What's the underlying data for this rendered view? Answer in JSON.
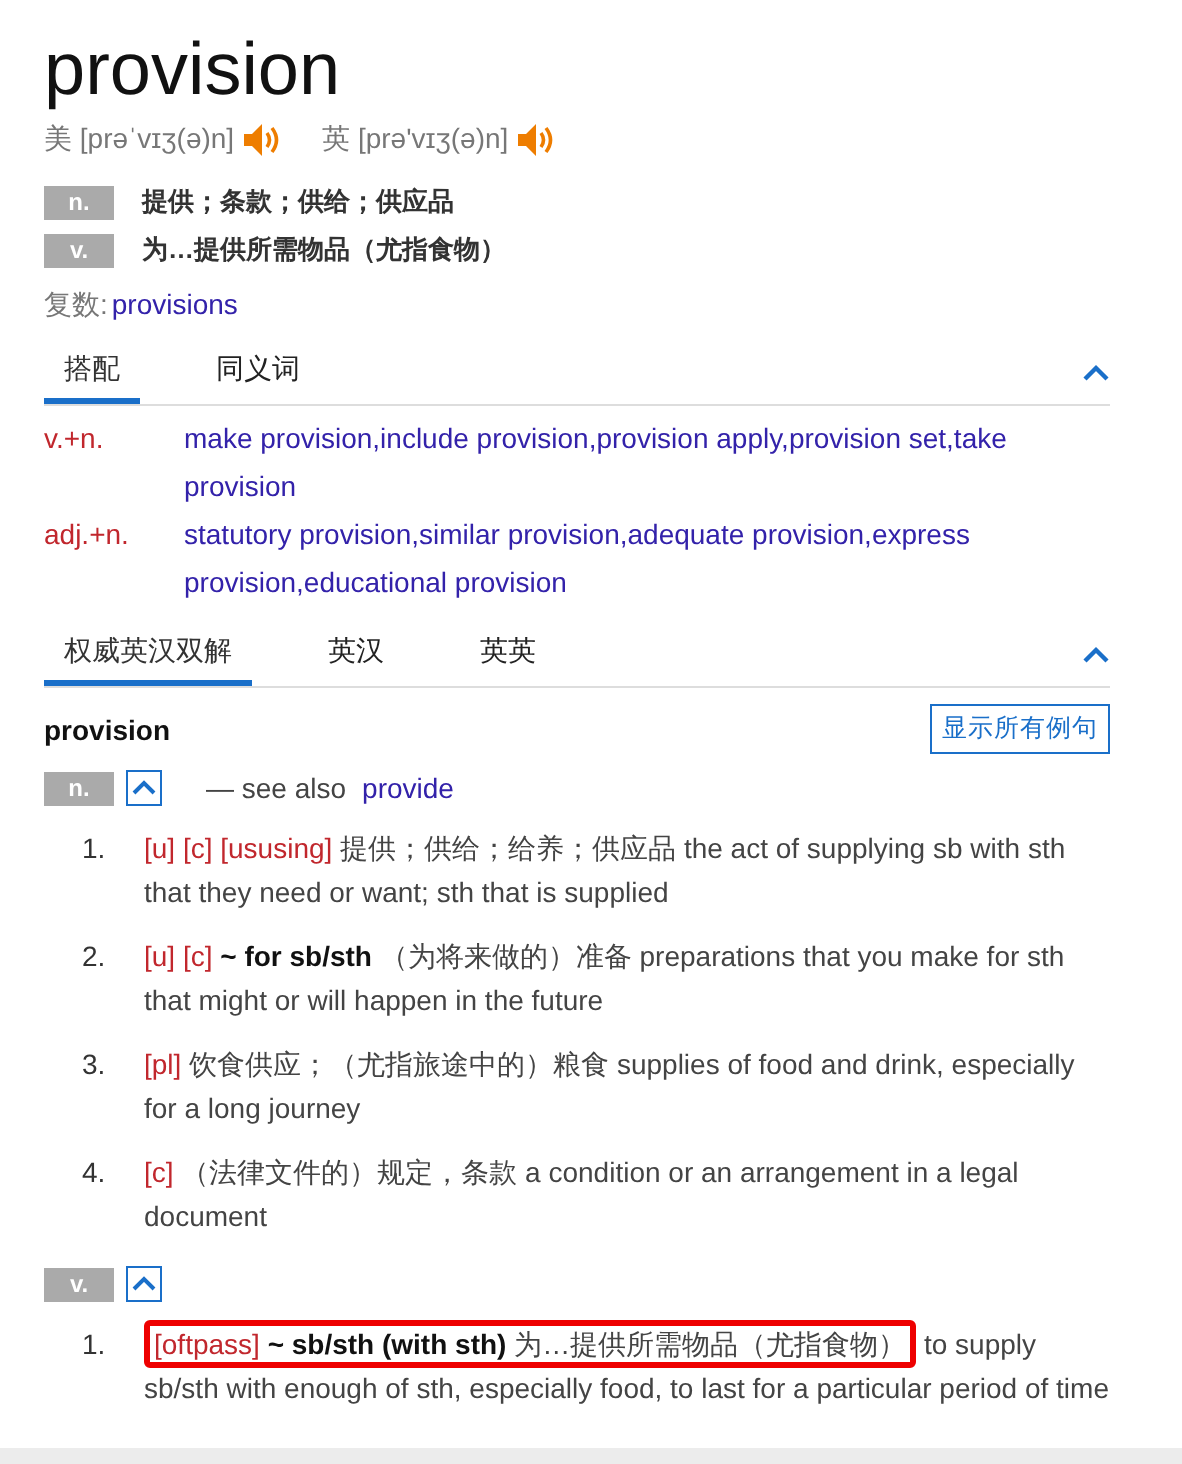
{
  "headword": "provision",
  "pronunciations": [
    {
      "region": "美",
      "phonetic": "[prəˈvɪʒ(ə)n]"
    },
    {
      "region": "英",
      "phonetic": "[prə'vɪʒ(ə)n]"
    }
  ],
  "meanings": [
    {
      "pos": "n.",
      "text": "提供；条款；供给；供应品"
    },
    {
      "pos": "v.",
      "text": "为…提供所需物品（尤指食物）"
    }
  ],
  "plural": {
    "label": "复数:",
    "value": "provisions"
  },
  "collocation_tabs": [
    {
      "label": "搭配",
      "selected": true
    },
    {
      "label": "同义词",
      "selected": false
    }
  ],
  "collocations": [
    {
      "pattern": "v.+n.",
      "text": "make provision,include provision,provision apply,provision set,take provision"
    },
    {
      "pattern": "adj.+n.",
      "text": "statutory provision,similar provision,adequate provision,express provision,educational provision"
    }
  ],
  "dict_tabs": [
    {
      "label": "权威英汉双解",
      "selected": true
    },
    {
      "label": "英汉",
      "selected": false
    },
    {
      "label": "英英",
      "selected": false
    }
  ],
  "entry": {
    "word": "provision",
    "show_examples": "显示所有例句",
    "groups": [
      {
        "pos": "n.",
        "see_also_label": "— see also",
        "see_also": "provide",
        "senses": [
          {
            "number": "1.",
            "tags": "[u] [c] [ususing]",
            "head": "提供；供给；给养；供应品",
            "gloss": "the act of supplying sb with sth that they need or want; sth that is supplied",
            "highlighted": false
          },
          {
            "number": "2.",
            "tags": "[u] [c]",
            "head": "**~ for sb/sth** （为将来做的）准备",
            "gloss": "preparations that you make for sth that might or will happen in the future",
            "highlighted": false
          },
          {
            "number": "3.",
            "tags": "[pl]",
            "head": "饮食供应；（尤指旅途中的）粮食",
            "gloss": "supplies of food and drink, especially for a long journey",
            "highlighted": false
          },
          {
            "number": "4.",
            "tags": "[c]",
            "head": "（法律文件的）规定，条款",
            "gloss": "a condition or an arrangement in a legal document",
            "highlighted": false
          }
        ]
      },
      {
        "pos": "v.",
        "senses": [
          {
            "number": "1.",
            "tags": "[oftpass]",
            "head": "**~ sb/sth (with sth)** 为…提供所需物品（尤指食物）",
            "gloss": "to supply sb/sth with enough of sth, especially food, to last for a particular period of time",
            "highlighted": true
          }
        ]
      }
    ]
  }
}
